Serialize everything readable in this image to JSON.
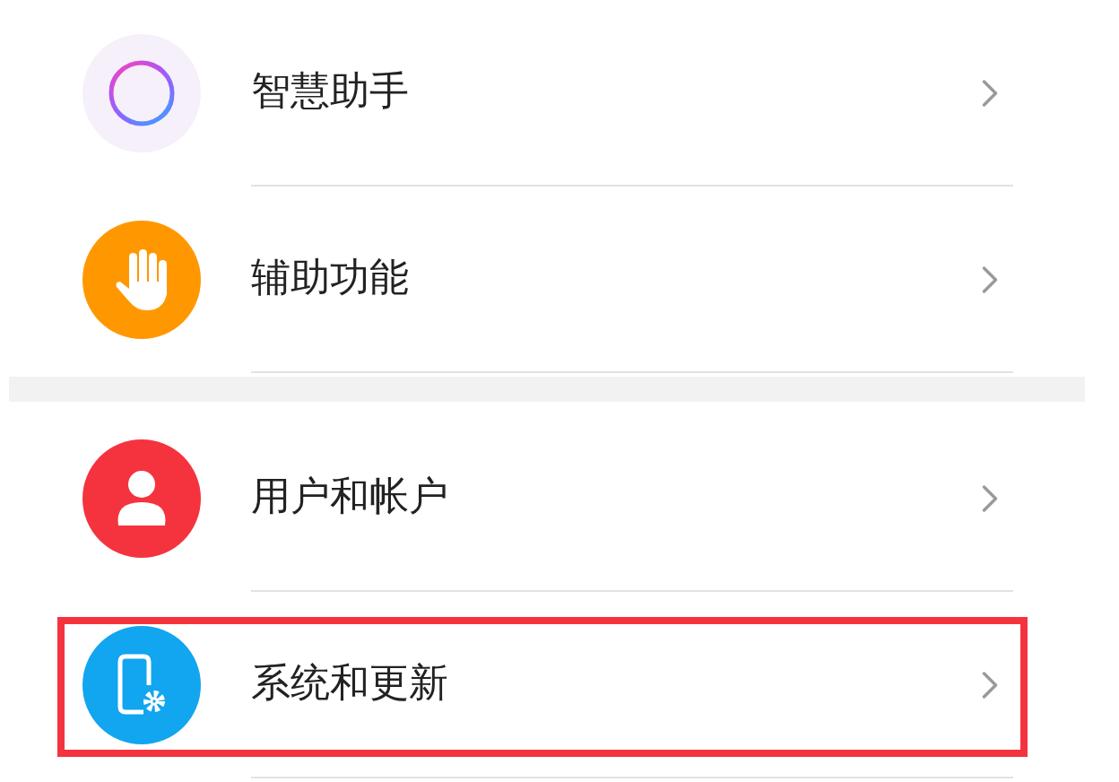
{
  "groups": [
    {
      "items": [
        {
          "label": "智慧助手",
          "highlighted": false
        },
        {
          "label": "辅助功能",
          "highlighted": false
        }
      ]
    },
    {
      "items": [
        {
          "label": "用户和帐户",
          "highlighted": false
        },
        {
          "label": "系统和更新",
          "highlighted": true
        }
      ]
    }
  ]
}
